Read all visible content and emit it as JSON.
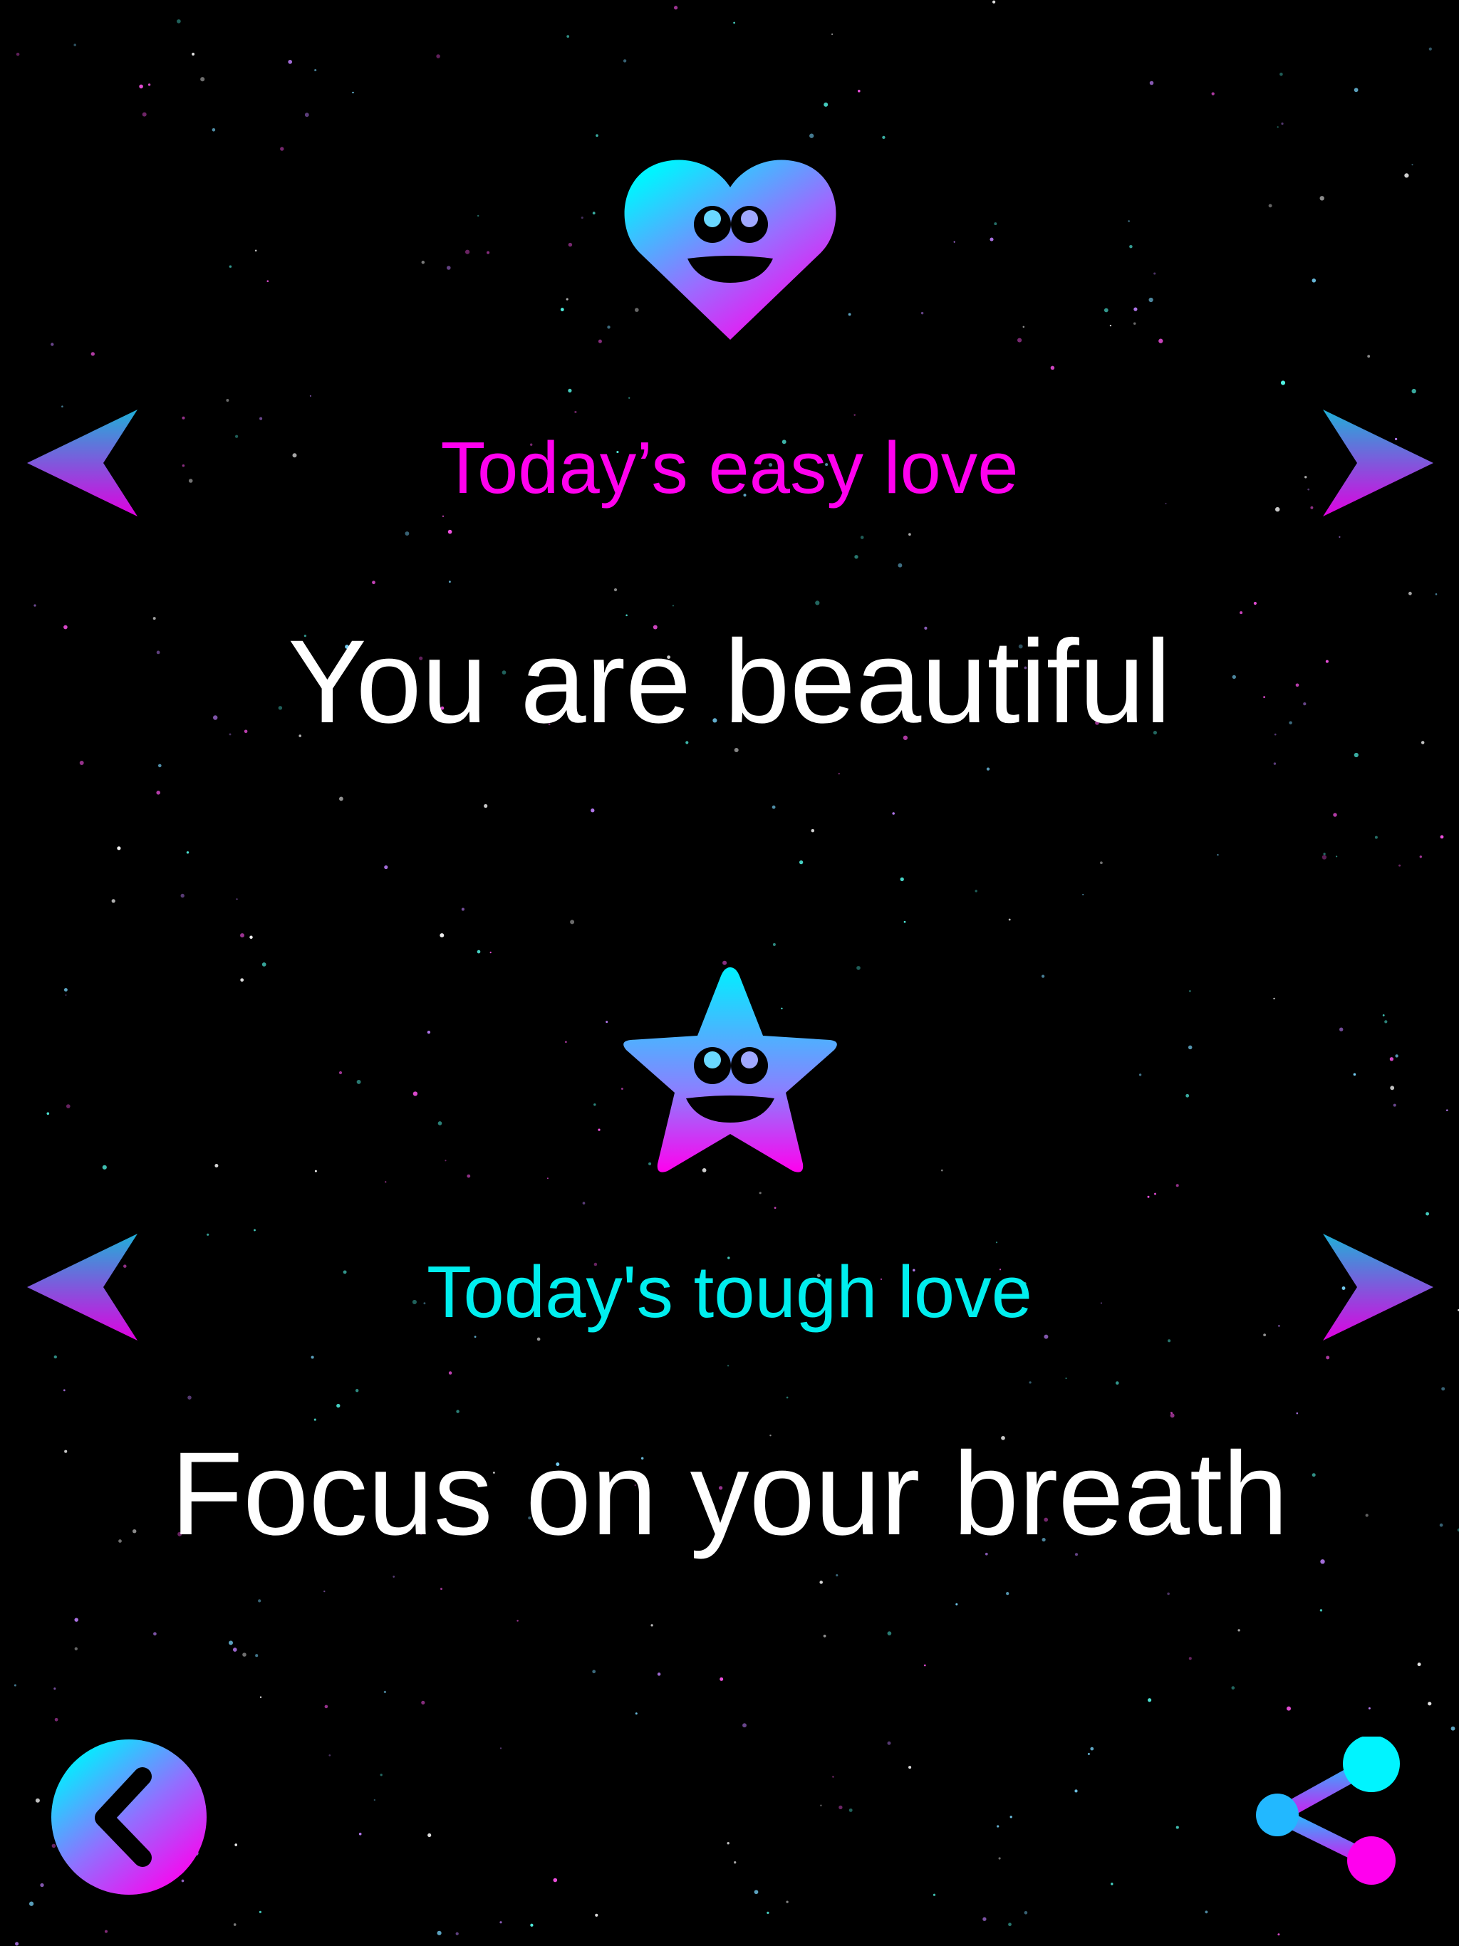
{
  "colors": {
    "background": "#000000",
    "gradient_cyan": "#00f0ff",
    "gradient_magenta": "#ff00ee",
    "easy_label": "#ff00ee",
    "tough_label": "#00eeee",
    "affirmation_text": "#ffffff"
  },
  "easy": {
    "icon": "smiling-heart-icon",
    "label": "Today’s easy love",
    "message": "You are beautiful",
    "prev_icon": "arrow-left-icon",
    "next_icon": "arrow-right-icon"
  },
  "tough": {
    "icon": "smiling-star-icon",
    "label": "Today's tough love",
    "message": "Focus on your breath",
    "prev_icon": "arrow-left-icon",
    "next_icon": "arrow-right-icon"
  },
  "footer": {
    "back_icon": "back-chevron-icon",
    "share_icon": "share-icon"
  }
}
